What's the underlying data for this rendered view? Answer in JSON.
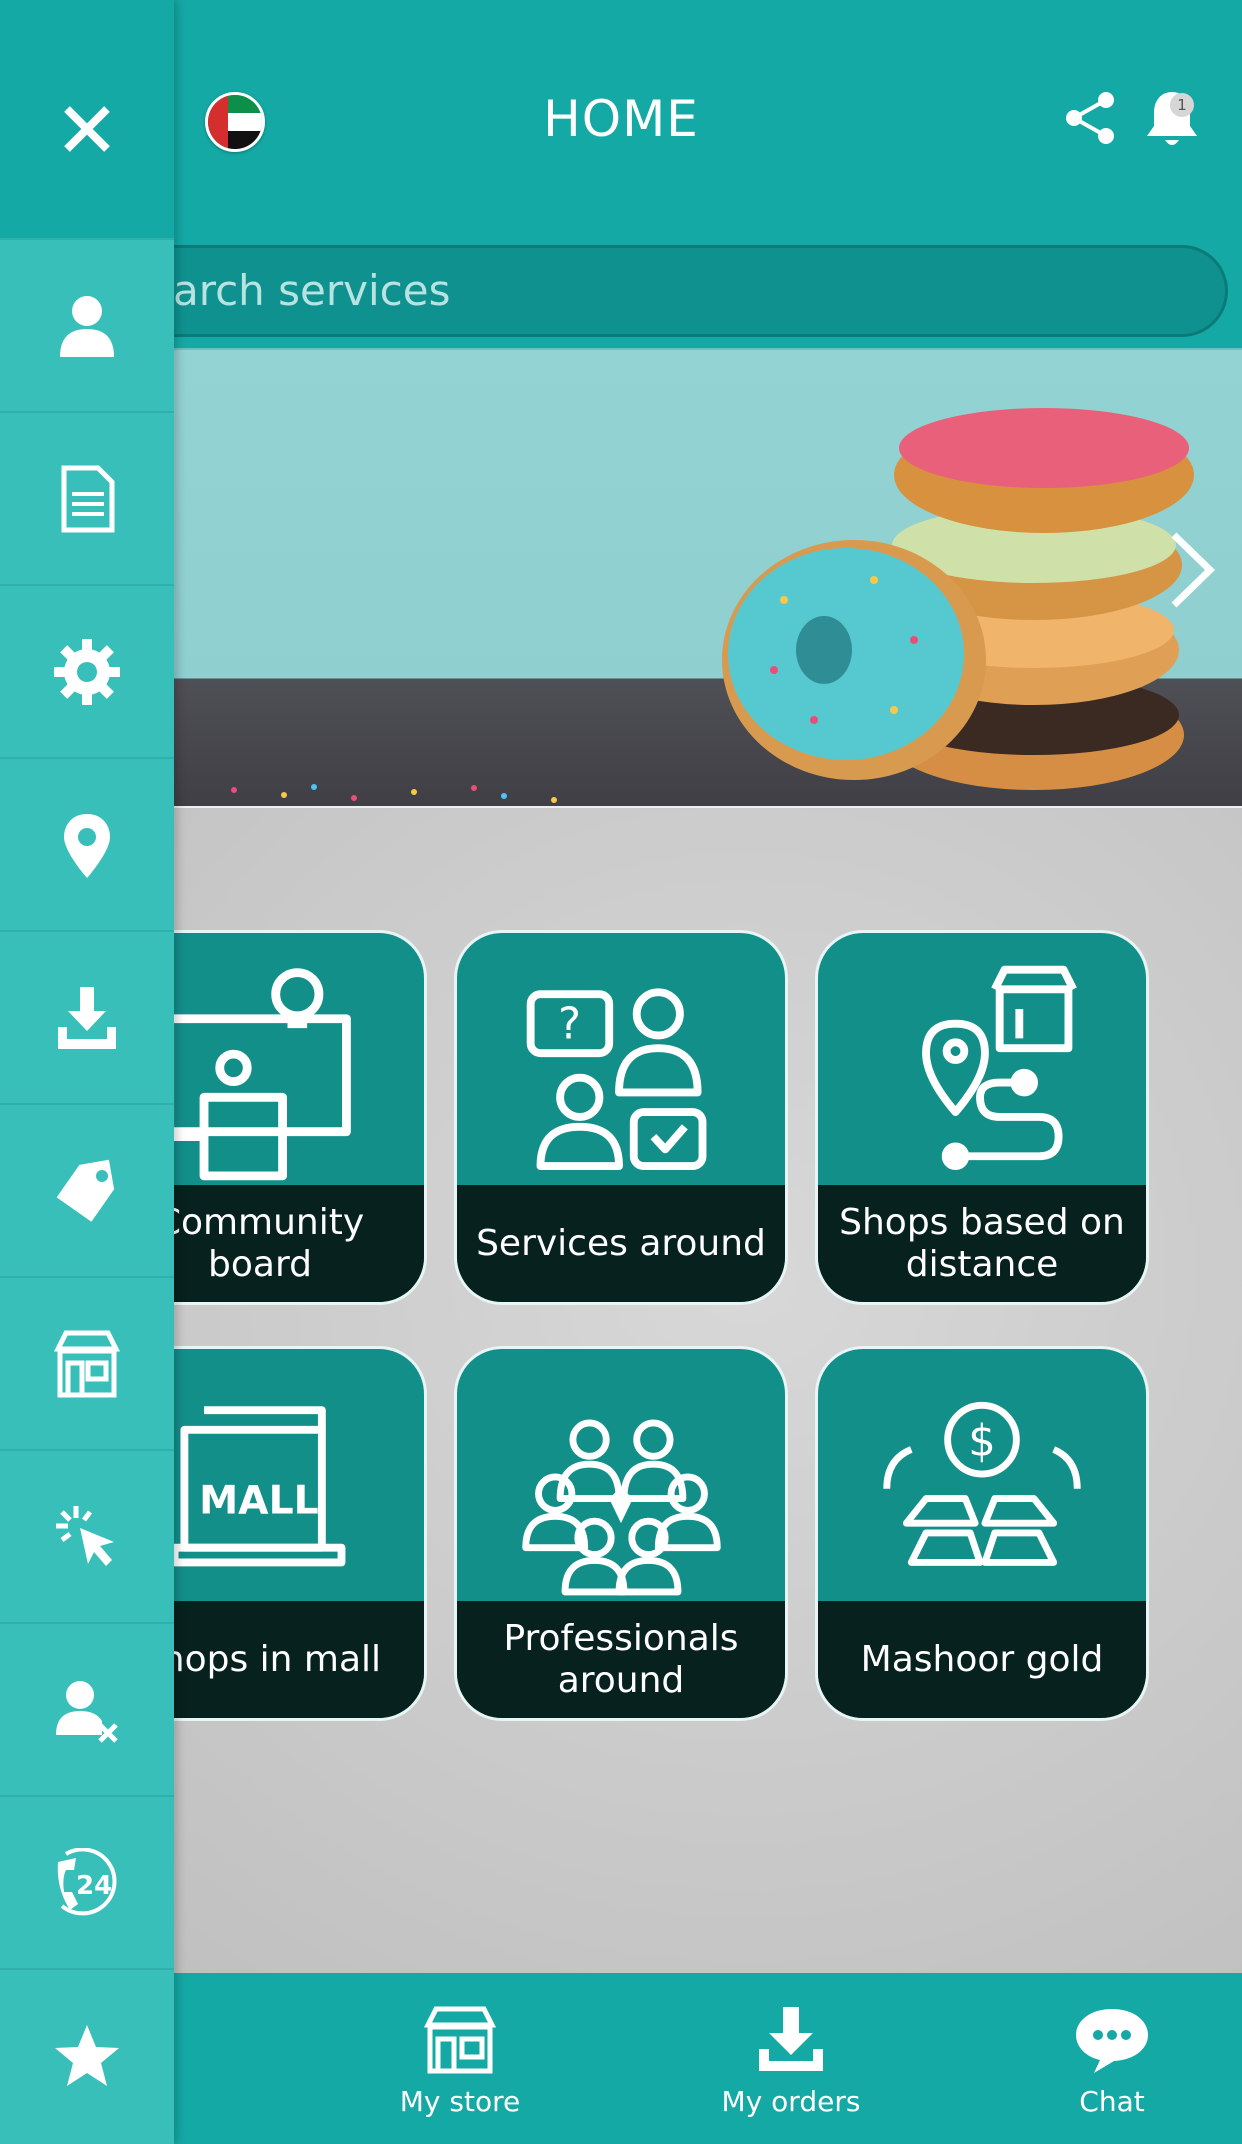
{
  "header": {
    "title": "HOME",
    "notification_count": "1",
    "country_flag": "uae-flag-icon",
    "accent_color": "#15a9a5"
  },
  "search": {
    "placeholder": "Search services",
    "visible_text": "arch services"
  },
  "banner": {
    "image": "donuts-image",
    "next_icon": "chevron-right-icon"
  },
  "tiles": [
    {
      "label": "Community board",
      "icon": "community-board-icon"
    },
    {
      "label": "Services around",
      "icon": "services-around-icon"
    },
    {
      "label": "Shops based on distance",
      "icon": "shops-distance-icon"
    },
    {
      "label": "Shops in mall",
      "icon": "mall-icon"
    },
    {
      "label": "Professionals around",
      "icon": "professionals-icon"
    },
    {
      "label": "Mashoor gold",
      "icon": "gold-icon"
    }
  ],
  "sidebar": {
    "close_icon": "close-icon",
    "items": [
      {
        "icon": "user-icon"
      },
      {
        "icon": "document-icon"
      },
      {
        "icon": "gear-icon"
      },
      {
        "icon": "location-pin-icon"
      },
      {
        "icon": "download-icon"
      },
      {
        "icon": "tag-icon"
      },
      {
        "icon": "store-icon"
      },
      {
        "icon": "click-icon"
      },
      {
        "icon": "remove-user-icon"
      },
      {
        "icon": "support-24-icon"
      },
      {
        "icon": "star-icon"
      }
    ]
  },
  "bottom_nav": {
    "my_store": "My store",
    "my_orders": "My orders",
    "chat": "Chat"
  }
}
